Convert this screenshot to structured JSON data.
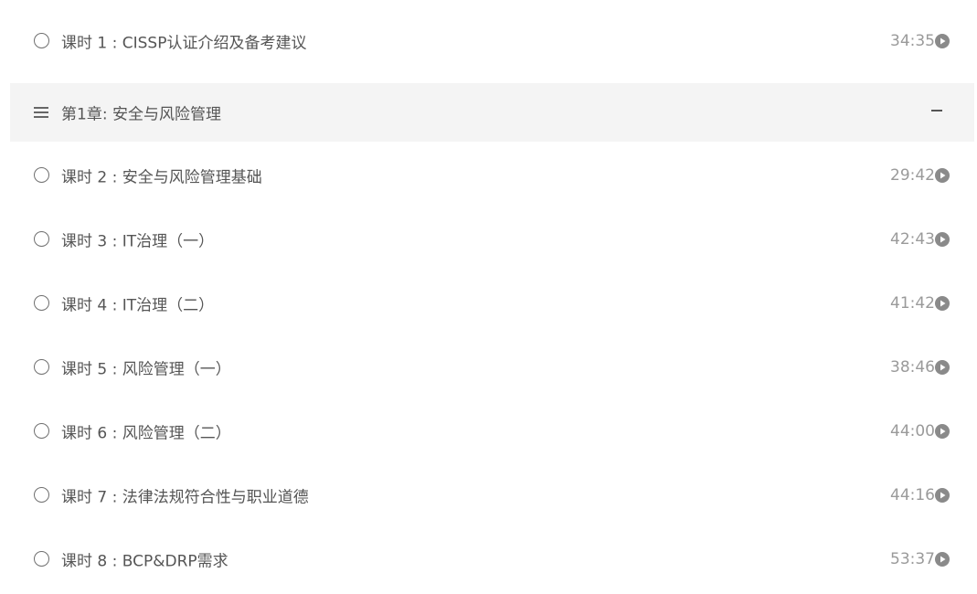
{
  "intro_lesson": {
    "title": "课时 1 : CISSP认证介绍及备考建议",
    "duration": "34:35"
  },
  "chapter": {
    "title": "第1章: 安全与风险管理"
  },
  "lessons": [
    {
      "title": "课时 2 : 安全与风险管理基础",
      "duration": "29:42"
    },
    {
      "title": "课时 3 : IT治理（一）",
      "duration": "42:43"
    },
    {
      "title": "课时 4 : IT治理（二）",
      "duration": "41:42"
    },
    {
      "title": "课时 5 : 风险管理（一）",
      "duration": "38:46"
    },
    {
      "title": "课时 6 : 风险管理（二）",
      "duration": "44:00"
    },
    {
      "title": "课时 7 : 法律法规符合性与职业道德",
      "duration": "44:16"
    },
    {
      "title": "课时 8 : BCP&DRP需求",
      "duration": "53:37"
    }
  ],
  "icons": {
    "status": "circle-outline-icon",
    "play": "play-circle-icon",
    "chapter": "menu-icon",
    "collapse": "minus-icon"
  },
  "colors": {
    "text": "#555555",
    "duration": "#9a9a9a",
    "play_icon": "#8a8a8a",
    "chapter_bg": "#f4f4f4"
  }
}
